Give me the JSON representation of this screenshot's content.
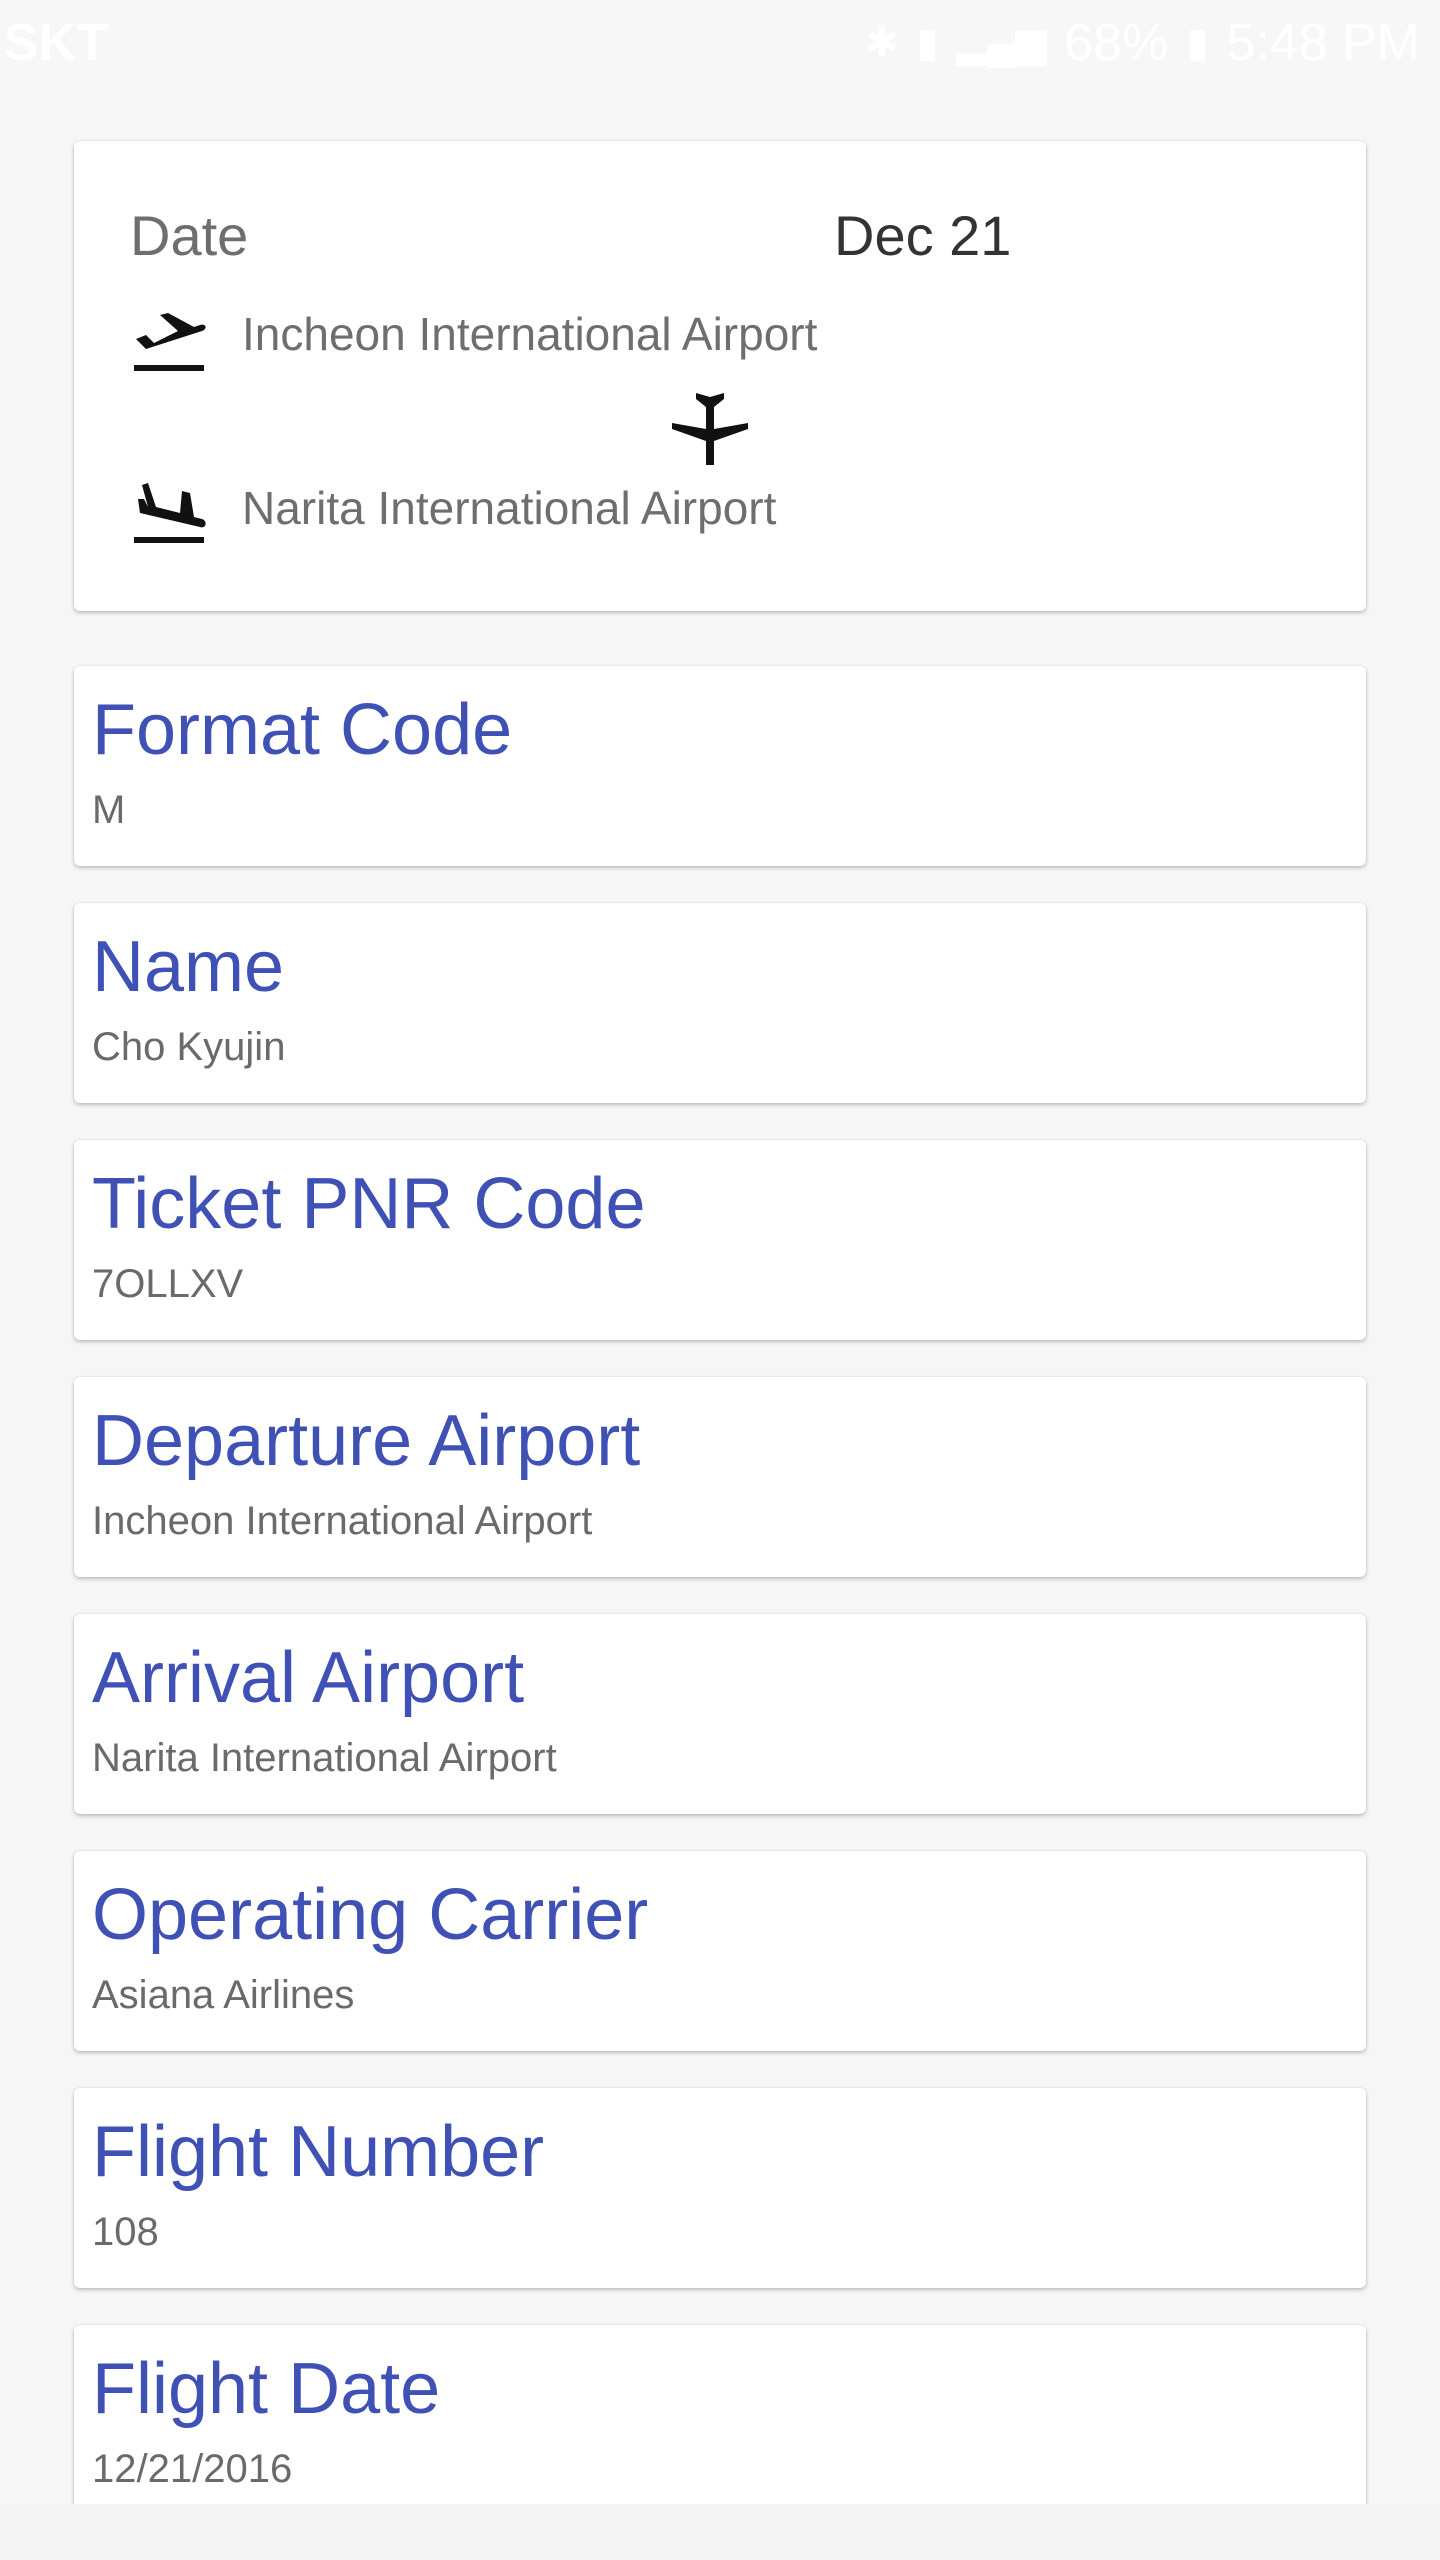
{
  "status_bar": {
    "carrier": "SKT",
    "battery": "68%",
    "time": "5:48 PM",
    "icons": [
      "bluetooth-icon",
      "vibrate-icon",
      "lte-icon",
      "signal-icon",
      "battery-icon"
    ]
  },
  "summary": {
    "date_label": "Date",
    "date_value": "Dec 21",
    "departure_airport": "Incheon International Airport",
    "arrival_airport": "Narita International Airport",
    "icons": [
      "flight-takeoff-icon",
      "airplane-icon",
      "flight-land-icon"
    ]
  },
  "fields": [
    {
      "label": "Format Code",
      "value": "M"
    },
    {
      "label": "Name",
      "value": "Cho Kyujin"
    },
    {
      "label": "Ticket PNR Code",
      "value": "7OLLXV"
    },
    {
      "label": "Departure Airport",
      "value": "Incheon International Airport"
    },
    {
      "label": "Arrival Airport",
      "value": "Narita International Airport"
    },
    {
      "label": "Operating Carrier",
      "value": "Asiana Airlines"
    },
    {
      "label": "Flight Number",
      "value": "108"
    },
    {
      "label": "Flight Date",
      "value": "12/21/2016"
    }
  ],
  "colors": {
    "label": "#3f51b5",
    "value": "#6a6a6a",
    "background": "#f6f6f6"
  }
}
